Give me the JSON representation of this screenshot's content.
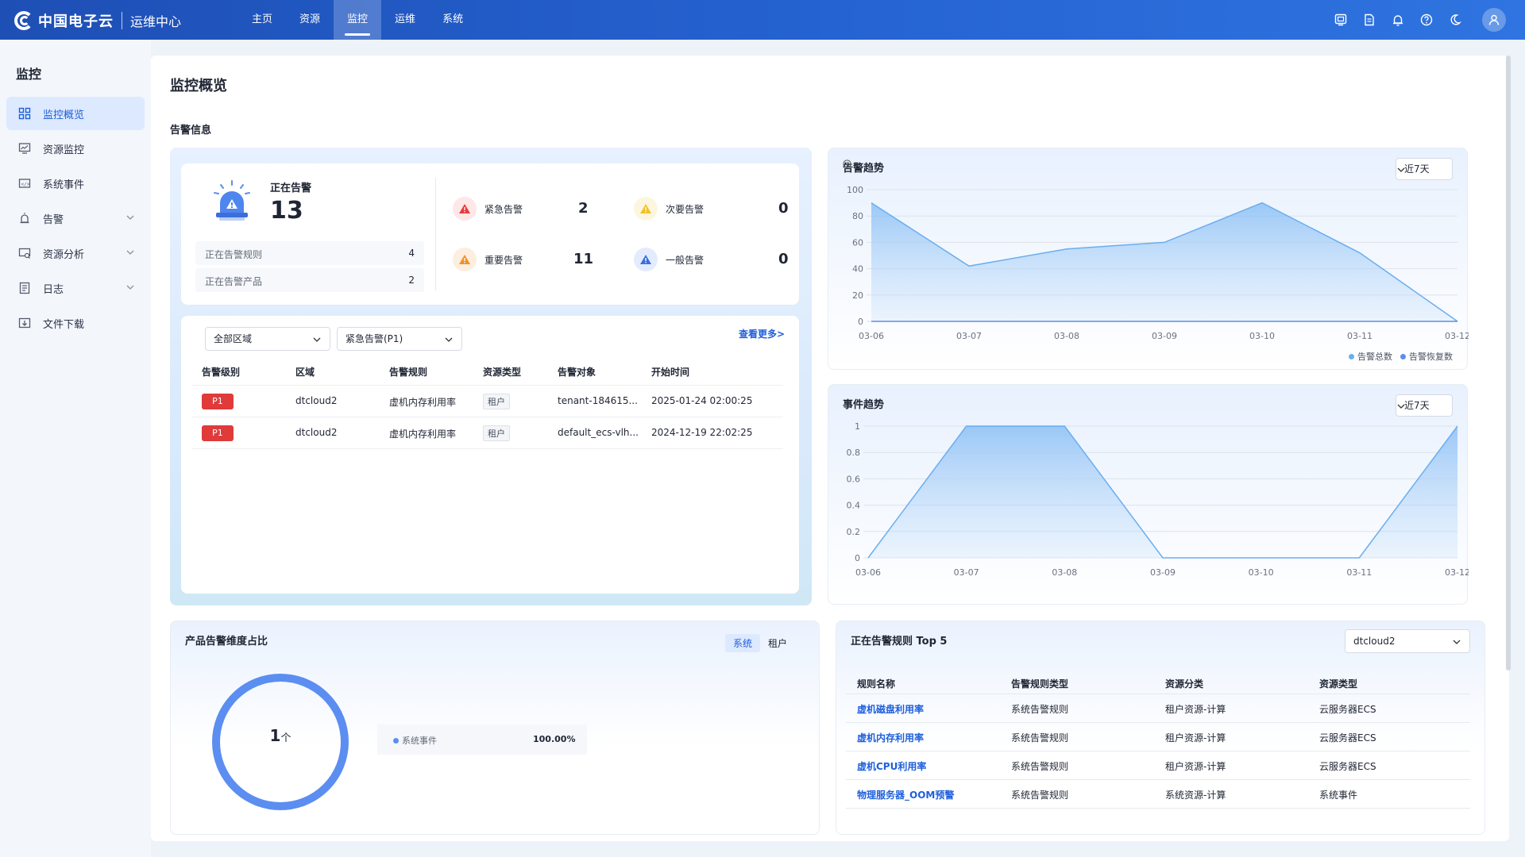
{
  "header": {
    "brand": "中国电子云",
    "subtitle": "运维中心",
    "nav": [
      "主页",
      "资源",
      "监控",
      "运维",
      "系统"
    ],
    "active_nav": "监控",
    "icons": [
      "screen-icon",
      "document-icon",
      "bell-icon",
      "help-icon",
      "moon-icon",
      "user-icon"
    ]
  },
  "sidebar": {
    "title": "监控",
    "items": [
      {
        "label": "监控概览",
        "icon": "grid-icon",
        "active": true
      },
      {
        "label": "资源监控",
        "icon": "monitor-icon"
      },
      {
        "label": "系统事件",
        "icon": "event-icon"
      },
      {
        "label": "告警",
        "icon": "alarm-icon",
        "expandable": true
      },
      {
        "label": "资源分析",
        "icon": "analysis-icon",
        "expandable": true
      },
      {
        "label": "日志",
        "icon": "log-icon",
        "expandable": true
      },
      {
        "label": "文件下载",
        "icon": "download-icon"
      }
    ]
  },
  "page": {
    "title": "监控概览",
    "section_title": "告警信息"
  },
  "alerts": {
    "current_label": "正在告警",
    "current_count": "13",
    "stats": [
      {
        "label": "正在告警规则",
        "value": "4"
      },
      {
        "label": "正在告警产品",
        "value": "2"
      }
    ],
    "levels": [
      {
        "label": "紧急告警",
        "value": "2",
        "color": "#e53b3b"
      },
      {
        "label": "次要告警",
        "value": "0",
        "color": "#f2c029"
      },
      {
        "label": "重要告警",
        "value": "11",
        "color": "#f0902c"
      },
      {
        "label": "一般告警",
        "value": "0",
        "color": "#3a6ee0"
      }
    ]
  },
  "alert_list": {
    "region_select": "全部区域",
    "level_select": "紧急告警(P1)",
    "more": "查看更多>",
    "columns": [
      "告警级别",
      "区域",
      "告警规则",
      "资源类型",
      "告警对象",
      "开始时间"
    ],
    "rows": [
      {
        "level": "P1",
        "region": "dtcloud2",
        "rule": "虚机内存利用率",
        "type": "租户",
        "target": "tenant-184615...",
        "time": "2025-01-24 02:00:25"
      },
      {
        "level": "P1",
        "region": "dtcloud2",
        "rule": "虚机内存利用率",
        "type": "租户",
        "target": "default_ecs-vlh...",
        "time": "2024-12-19 22:02:25"
      }
    ]
  },
  "alarm_trend": {
    "title": "告警趋势",
    "range": "近7天",
    "legend": [
      "告警总数",
      "告警恢复数"
    ]
  },
  "event_trend": {
    "title": "事件趋势",
    "range": "近7天"
  },
  "chart_data": [
    {
      "type": "area",
      "title": "告警趋势",
      "x": [
        "03-06",
        "03-07",
        "03-08",
        "03-09",
        "03-10",
        "03-11",
        "03-12"
      ],
      "ylim": [
        0,
        100
      ],
      "yticks": [
        "0",
        "20",
        "40",
        "60",
        "80",
        "100"
      ],
      "series": [
        {
          "name": "告警总数",
          "values": [
            90,
            42,
            55,
            60,
            90,
            52,
            0
          ],
          "color": "#6aaef0"
        },
        {
          "name": "告警恢复数",
          "values": [
            0,
            0,
            0,
            0,
            0,
            0,
            0
          ],
          "color": "#5b8ef0"
        }
      ],
      "grid": true,
      "legend": "bottom-right"
    },
    {
      "type": "area",
      "title": "事件趋势",
      "x": [
        "03-06",
        "03-07",
        "03-08",
        "03-09",
        "03-10",
        "03-11",
        "03-12"
      ],
      "ylim": [
        0,
        1
      ],
      "yticks": [
        "0",
        "0.2",
        "0.4",
        "0.6",
        "0.8",
        "1"
      ],
      "series": [
        {
          "values": [
            0,
            1,
            1,
            0,
            0,
            0,
            1
          ],
          "color": "#6aaef0"
        }
      ],
      "grid": true
    }
  ],
  "product_ratio": {
    "title": "产品告警维度占比",
    "tabs": [
      "系统",
      "租户"
    ],
    "active_tab": "系统",
    "total": "1",
    "unit": "个",
    "items": [
      {
        "name": "系统事件",
        "percent": "100.00%",
        "color": "#5b8ef0"
      }
    ]
  },
  "top_rules": {
    "title": "正在告警规则 Top 5",
    "select": "dtcloud2",
    "columns": [
      "规则名称",
      "告警规则类型",
      "资源分类",
      "资源类型"
    ],
    "rows": [
      {
        "name": "虚机磁盘利用率",
        "rule_type": "系统告警规则",
        "category": "租户资源-计算",
        "resource": "云服务器ECS"
      },
      {
        "name": "虚机内存利用率",
        "rule_type": "系统告警规则",
        "category": "租户资源-计算",
        "resource": "云服务器ECS"
      },
      {
        "name": "虚机CPU利用率",
        "rule_type": "系统告警规则",
        "category": "租户资源-计算",
        "resource": "云服务器ECS"
      },
      {
        "name": "物理服务器_OOM预警",
        "rule_type": "系统告警规则",
        "category": "系统资源-计算",
        "resource": "系统事件"
      }
    ]
  }
}
